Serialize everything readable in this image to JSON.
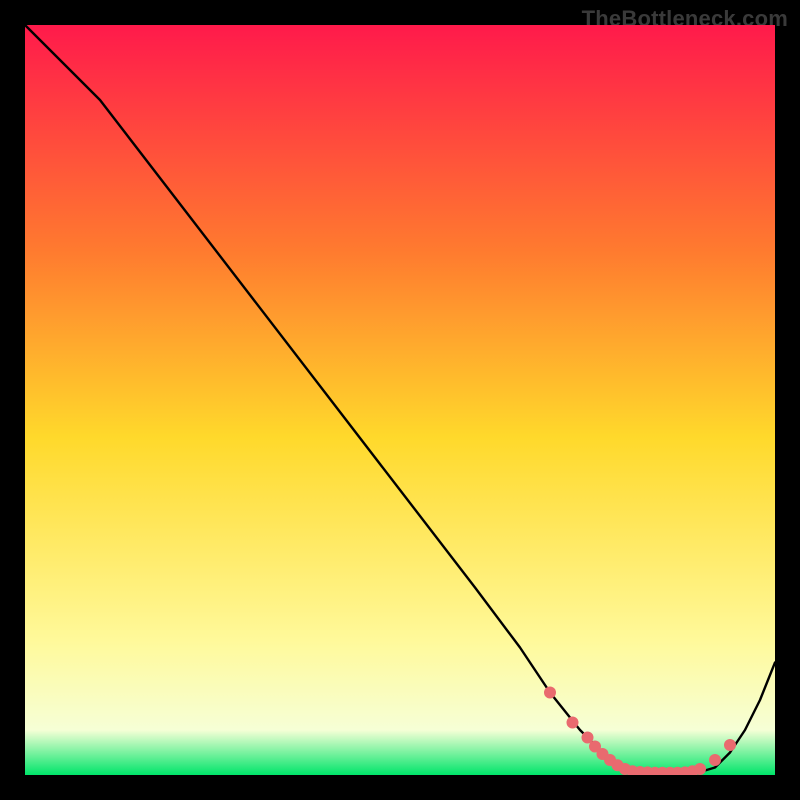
{
  "watermark": "TheBottleneck.com",
  "colors": {
    "bg": "#000000",
    "grad_top": "#ff1a4b",
    "grad_mid_upper": "#ff7a2f",
    "grad_mid": "#ffd92b",
    "grad_lower": "#fff99a",
    "grad_bottom_pale": "#f6ffd6",
    "grad_bottom": "#00e56a",
    "curve": "#000000",
    "marker": "#e96a6f"
  },
  "chart_data": {
    "type": "line",
    "title": "",
    "xlabel": "",
    "ylabel": "",
    "xlim": [
      0,
      100
    ],
    "ylim": [
      0,
      100
    ],
    "grid": false,
    "legend": false,
    "series": [
      {
        "name": "curve",
        "x": [
          0,
          6,
          10,
          20,
          30,
          40,
          50,
          60,
          66,
          70,
          74,
          78,
          80,
          82,
          84,
          86,
          88,
          90,
          92,
          94,
          96,
          98,
          100
        ],
        "y": [
          100,
          94,
          90,
          77,
          64,
          51,
          38,
          25,
          17,
          11,
          6,
          2,
          0.8,
          0.4,
          0.3,
          0.3,
          0.3,
          0.4,
          1.0,
          3,
          6,
          10,
          15
        ]
      }
    ],
    "markers": {
      "name": "highlight",
      "x": [
        70,
        73,
        75,
        76,
        77,
        78,
        79,
        80,
        81,
        82,
        83,
        84,
        85,
        86,
        87,
        88,
        89,
        90,
        92,
        94
      ],
      "y": [
        11,
        7,
        5,
        3.8,
        2.8,
        2,
        1.3,
        0.8,
        0.5,
        0.4,
        0.35,
        0.3,
        0.3,
        0.3,
        0.3,
        0.35,
        0.5,
        0.8,
        2,
        4
      ]
    }
  }
}
